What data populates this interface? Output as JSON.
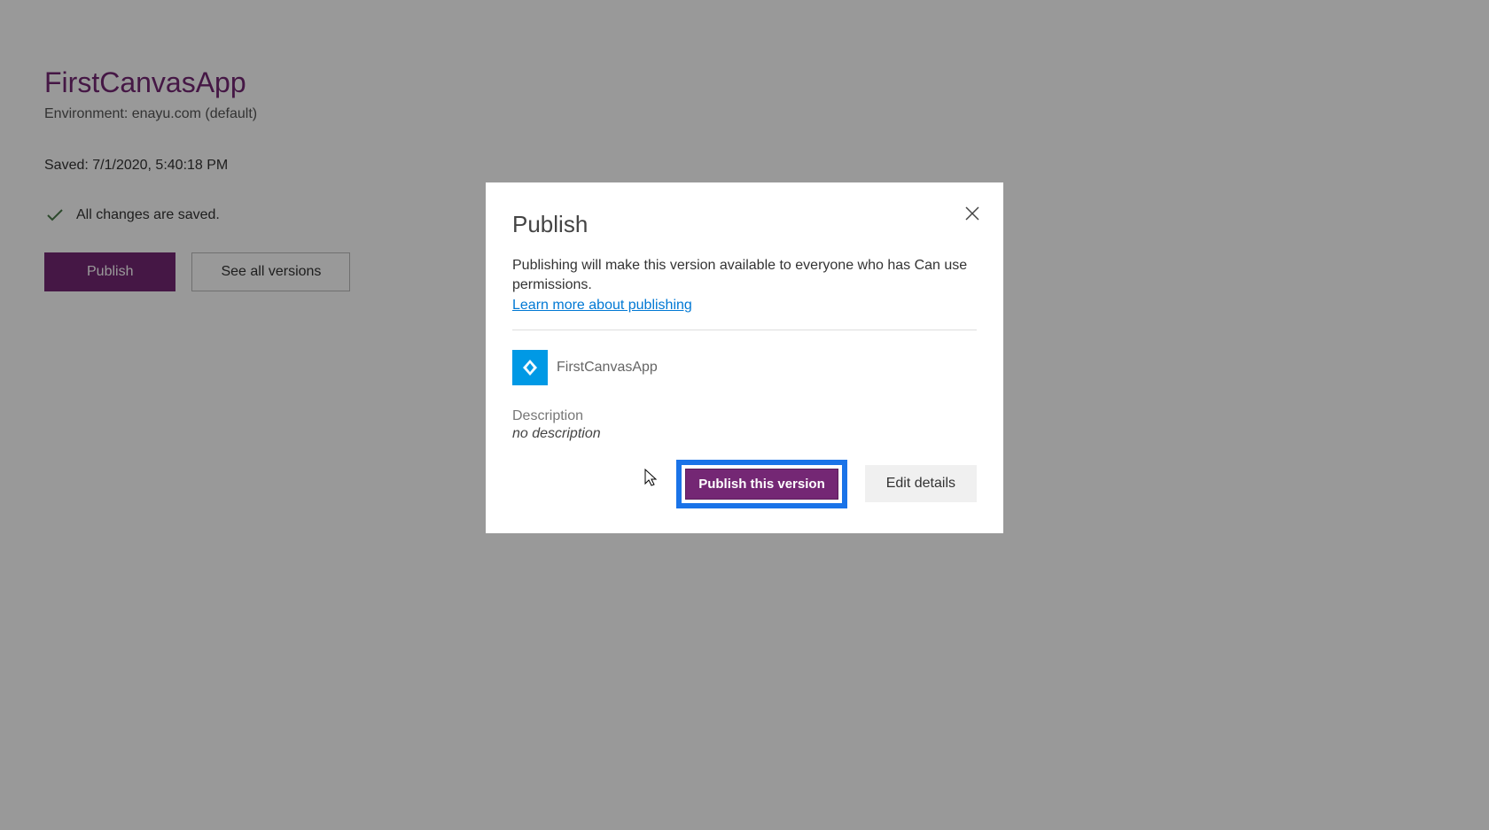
{
  "page": {
    "app_title": "FirstCanvasApp",
    "environment": "Environment: enayu.com (default)",
    "saved": "Saved: 7/1/2020, 5:40:18 PM",
    "status": "All changes are saved.",
    "publish_button": "Publish",
    "see_versions_button": "See all versions"
  },
  "modal": {
    "title": "Publish",
    "description": "Publishing will make this version available to everyone who has Can use permissions.",
    "learn_more": "Learn more about publishing",
    "app_name": "FirstCanvasApp",
    "description_label": "Description",
    "description_value": "no description",
    "publish_button": "Publish this version",
    "edit_button": "Edit details"
  }
}
